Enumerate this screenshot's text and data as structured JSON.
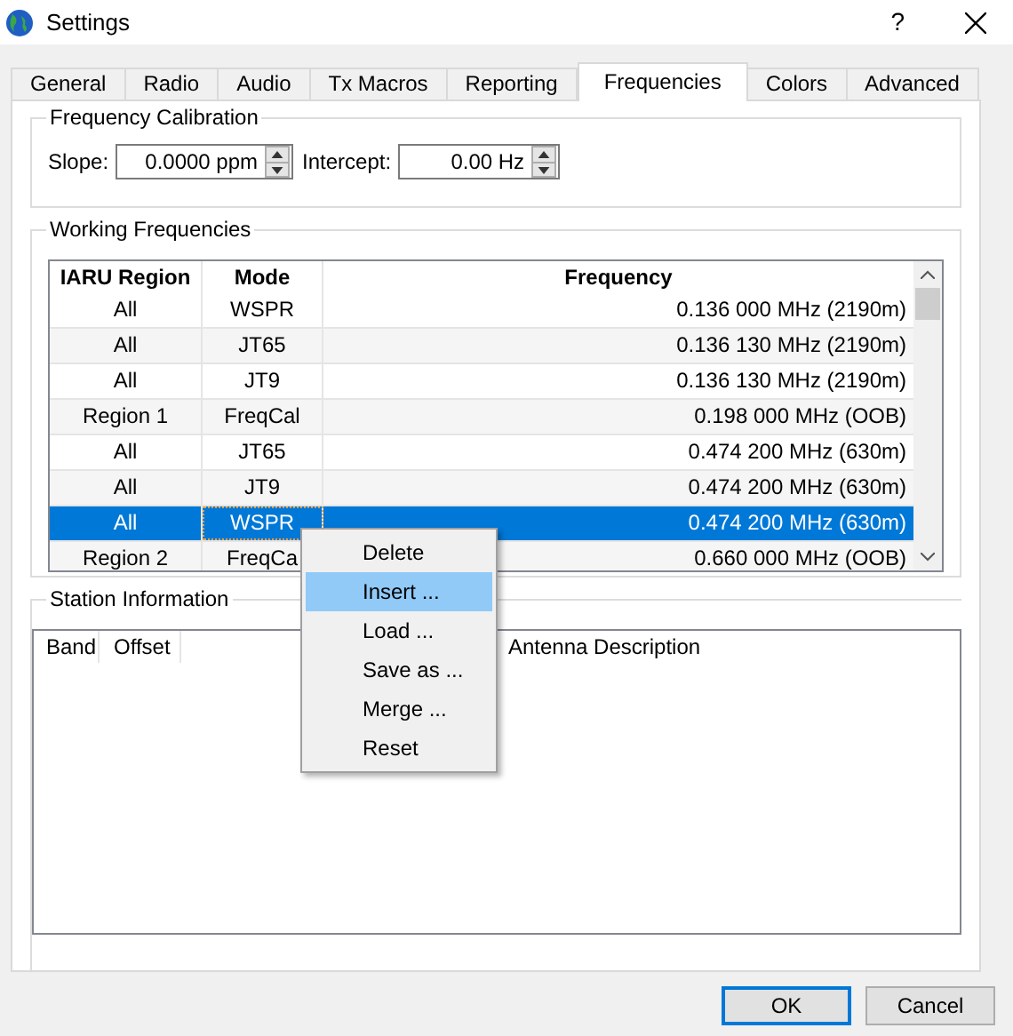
{
  "window": {
    "title": "Settings",
    "help": "?"
  },
  "tabs": [
    {
      "label": "General",
      "selected": false
    },
    {
      "label": "Radio",
      "selected": false
    },
    {
      "label": "Audio",
      "selected": false
    },
    {
      "label": "Tx Macros",
      "selected": false
    },
    {
      "label": "Reporting",
      "selected": false
    },
    {
      "label": "Frequencies",
      "selected": true
    },
    {
      "label": "Colors",
      "selected": false
    },
    {
      "label": "Advanced",
      "selected": false
    }
  ],
  "frequency_calibration": {
    "title": "Frequency Calibration",
    "slope_label": "Slope:",
    "slope_value": "0.0000 ppm",
    "intercept_label": "Intercept:",
    "intercept_value": "0.00 Hz"
  },
  "working_frequencies": {
    "title": "Working Frequencies",
    "columns": [
      "IARU Region",
      "Mode",
      "Frequency"
    ],
    "rows": [
      {
        "cells": [
          "All",
          "WSPR",
          "0.136 000 MHz (2190m)"
        ],
        "selected": false
      },
      {
        "cells": [
          "All",
          "JT65",
          "0.136 130 MHz (2190m)"
        ],
        "selected": false
      },
      {
        "cells": [
          "All",
          "JT9",
          "0.136 130 MHz (2190m)"
        ],
        "selected": false
      },
      {
        "cells": [
          "Region 1",
          "FreqCal",
          "0.198 000 MHz (OOB)"
        ],
        "selected": false
      },
      {
        "cells": [
          "All",
          "JT65",
          "0.474 200 MHz (630m)"
        ],
        "selected": false
      },
      {
        "cells": [
          "All",
          "JT9",
          "0.474 200 MHz (630m)"
        ],
        "selected": false
      },
      {
        "cells": [
          "All",
          "WSPR",
          "0.474 200 MHz (630m)"
        ],
        "selected": true
      },
      {
        "cells": [
          "Region 2",
          "FreqCa",
          "0.660 000 MHz (OOB)"
        ],
        "selected": false
      }
    ]
  },
  "station_information": {
    "title": "Station Information",
    "columns": [
      "Band",
      "Offset",
      "Antenna Description"
    ]
  },
  "context_menu": [
    {
      "label": "Delete",
      "selected": false
    },
    {
      "label": "Insert ...",
      "selected": true
    },
    {
      "label": "Load ...",
      "selected": false
    },
    {
      "label": "Save as ...",
      "selected": false
    },
    {
      "label": "Merge ...",
      "selected": false
    },
    {
      "label": "Reset",
      "selected": false
    }
  ],
  "buttons": [
    {
      "label": "OK",
      "selected": true
    },
    {
      "label": "Cancel",
      "selected": false
    }
  ]
}
